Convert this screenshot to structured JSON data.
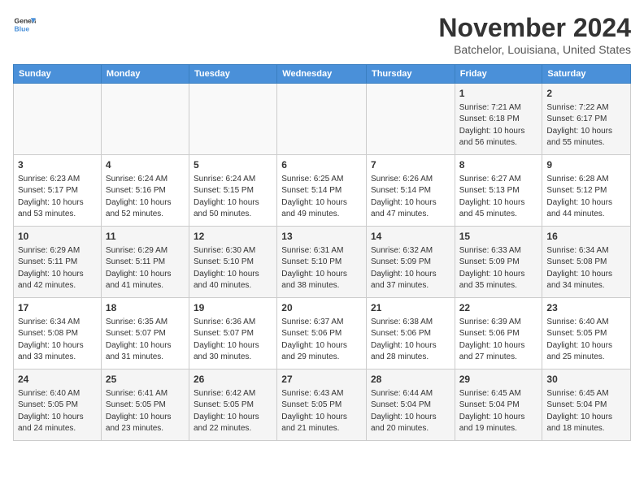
{
  "header": {
    "logo_line1": "General",
    "logo_line2": "Blue",
    "month_title": "November 2024",
    "location": "Batchelor, Louisiana, United States"
  },
  "weekdays": [
    "Sunday",
    "Monday",
    "Tuesday",
    "Wednesday",
    "Thursday",
    "Friday",
    "Saturday"
  ],
  "weeks": [
    [
      {
        "day": "",
        "info": ""
      },
      {
        "day": "",
        "info": ""
      },
      {
        "day": "",
        "info": ""
      },
      {
        "day": "",
        "info": ""
      },
      {
        "day": "",
        "info": ""
      },
      {
        "day": "1",
        "info": "Sunrise: 7:21 AM\nSunset: 6:18 PM\nDaylight: 10 hours\nand 56 minutes."
      },
      {
        "day": "2",
        "info": "Sunrise: 7:22 AM\nSunset: 6:17 PM\nDaylight: 10 hours\nand 55 minutes."
      }
    ],
    [
      {
        "day": "3",
        "info": "Sunrise: 6:23 AM\nSunset: 5:17 PM\nDaylight: 10 hours\nand 53 minutes."
      },
      {
        "day": "4",
        "info": "Sunrise: 6:24 AM\nSunset: 5:16 PM\nDaylight: 10 hours\nand 52 minutes."
      },
      {
        "day": "5",
        "info": "Sunrise: 6:24 AM\nSunset: 5:15 PM\nDaylight: 10 hours\nand 50 minutes."
      },
      {
        "day": "6",
        "info": "Sunrise: 6:25 AM\nSunset: 5:14 PM\nDaylight: 10 hours\nand 49 minutes."
      },
      {
        "day": "7",
        "info": "Sunrise: 6:26 AM\nSunset: 5:14 PM\nDaylight: 10 hours\nand 47 minutes."
      },
      {
        "day": "8",
        "info": "Sunrise: 6:27 AM\nSunset: 5:13 PM\nDaylight: 10 hours\nand 45 minutes."
      },
      {
        "day": "9",
        "info": "Sunrise: 6:28 AM\nSunset: 5:12 PM\nDaylight: 10 hours\nand 44 minutes."
      }
    ],
    [
      {
        "day": "10",
        "info": "Sunrise: 6:29 AM\nSunset: 5:11 PM\nDaylight: 10 hours\nand 42 minutes."
      },
      {
        "day": "11",
        "info": "Sunrise: 6:29 AM\nSunset: 5:11 PM\nDaylight: 10 hours\nand 41 minutes."
      },
      {
        "day": "12",
        "info": "Sunrise: 6:30 AM\nSunset: 5:10 PM\nDaylight: 10 hours\nand 40 minutes."
      },
      {
        "day": "13",
        "info": "Sunrise: 6:31 AM\nSunset: 5:10 PM\nDaylight: 10 hours\nand 38 minutes."
      },
      {
        "day": "14",
        "info": "Sunrise: 6:32 AM\nSunset: 5:09 PM\nDaylight: 10 hours\nand 37 minutes."
      },
      {
        "day": "15",
        "info": "Sunrise: 6:33 AM\nSunset: 5:09 PM\nDaylight: 10 hours\nand 35 minutes."
      },
      {
        "day": "16",
        "info": "Sunrise: 6:34 AM\nSunset: 5:08 PM\nDaylight: 10 hours\nand 34 minutes."
      }
    ],
    [
      {
        "day": "17",
        "info": "Sunrise: 6:34 AM\nSunset: 5:08 PM\nDaylight: 10 hours\nand 33 minutes."
      },
      {
        "day": "18",
        "info": "Sunrise: 6:35 AM\nSunset: 5:07 PM\nDaylight: 10 hours\nand 31 minutes."
      },
      {
        "day": "19",
        "info": "Sunrise: 6:36 AM\nSunset: 5:07 PM\nDaylight: 10 hours\nand 30 minutes."
      },
      {
        "day": "20",
        "info": "Sunrise: 6:37 AM\nSunset: 5:06 PM\nDaylight: 10 hours\nand 29 minutes."
      },
      {
        "day": "21",
        "info": "Sunrise: 6:38 AM\nSunset: 5:06 PM\nDaylight: 10 hours\nand 28 minutes."
      },
      {
        "day": "22",
        "info": "Sunrise: 6:39 AM\nSunset: 5:06 PM\nDaylight: 10 hours\nand 27 minutes."
      },
      {
        "day": "23",
        "info": "Sunrise: 6:40 AM\nSunset: 5:05 PM\nDaylight: 10 hours\nand 25 minutes."
      }
    ],
    [
      {
        "day": "24",
        "info": "Sunrise: 6:40 AM\nSunset: 5:05 PM\nDaylight: 10 hours\nand 24 minutes."
      },
      {
        "day": "25",
        "info": "Sunrise: 6:41 AM\nSunset: 5:05 PM\nDaylight: 10 hours\nand 23 minutes."
      },
      {
        "day": "26",
        "info": "Sunrise: 6:42 AM\nSunset: 5:05 PM\nDaylight: 10 hours\nand 22 minutes."
      },
      {
        "day": "27",
        "info": "Sunrise: 6:43 AM\nSunset: 5:05 PM\nDaylight: 10 hours\nand 21 minutes."
      },
      {
        "day": "28",
        "info": "Sunrise: 6:44 AM\nSunset: 5:04 PM\nDaylight: 10 hours\nand 20 minutes."
      },
      {
        "day": "29",
        "info": "Sunrise: 6:45 AM\nSunset: 5:04 PM\nDaylight: 10 hours\nand 19 minutes."
      },
      {
        "day": "30",
        "info": "Sunrise: 6:45 AM\nSunset: 5:04 PM\nDaylight: 10 hours\nand 18 minutes."
      }
    ]
  ]
}
